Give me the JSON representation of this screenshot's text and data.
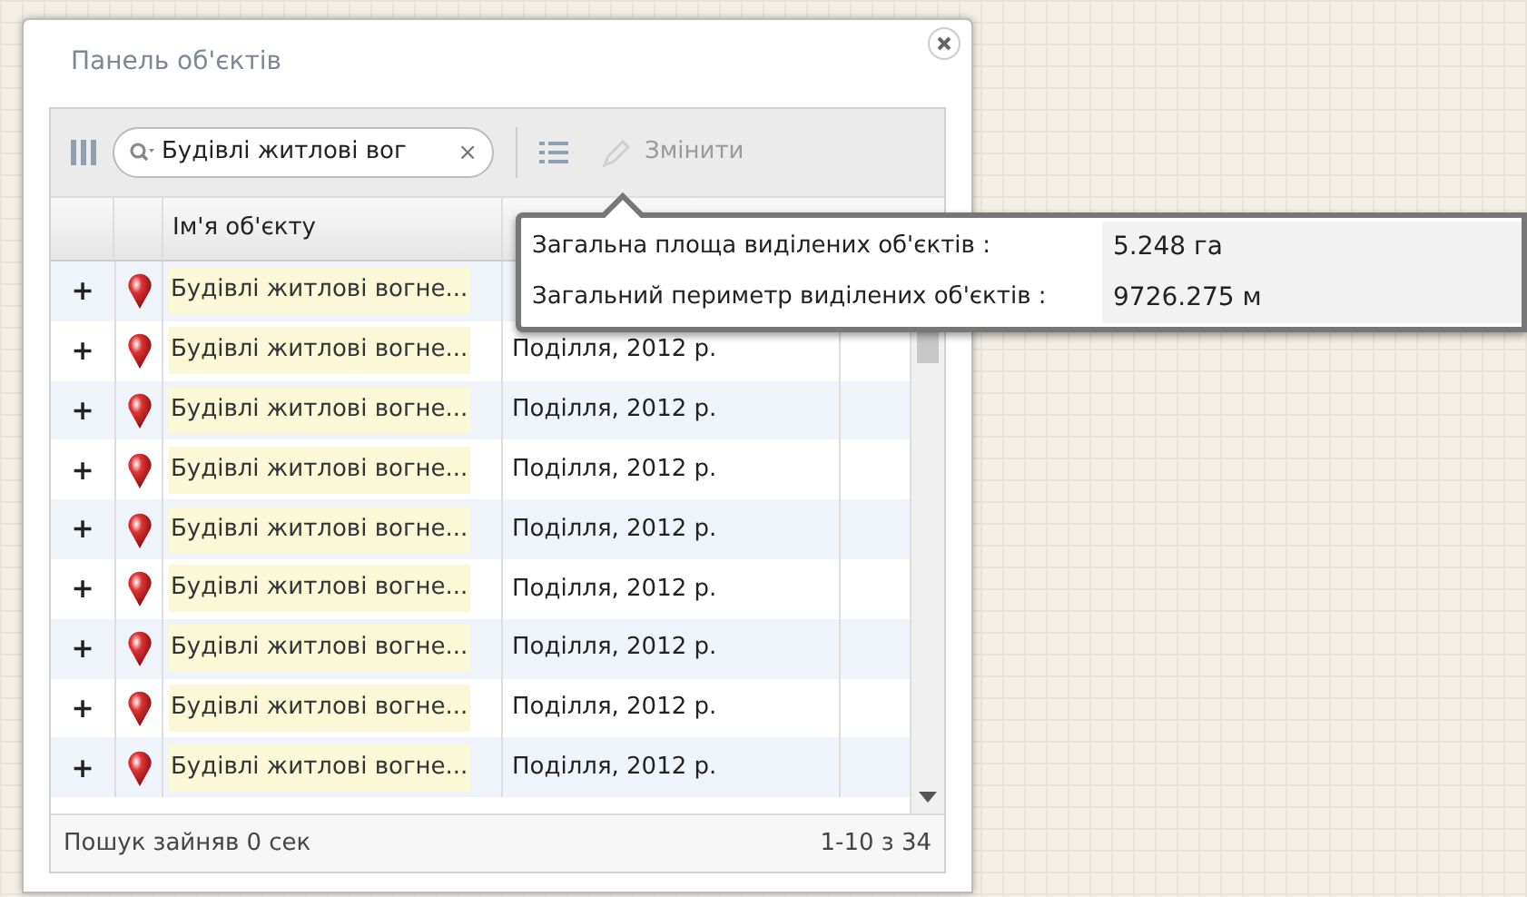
{
  "panel": {
    "title": "Панель об'єктів"
  },
  "toolbar": {
    "search": {
      "value": "Будівлі житлові вог",
      "clear": "×"
    },
    "edit_button": {
      "label": "Змінити",
      "disabled": true
    }
  },
  "table": {
    "columns": [
      "Ім'я об'єкту"
    ],
    "rows": [
      {
        "expand": "+",
        "name": "Будівлі житлові вогне..."
      },
      {
        "expand": "+",
        "name": "Будівлі житлові вогне...",
        "region": "Поділля, 2012 р."
      },
      {
        "expand": "+",
        "name": "Будівлі житлові вогне...",
        "region": "Поділля, 2012 р."
      },
      {
        "expand": "+",
        "name": "Будівлі житлові вогне...",
        "region": "Поділля, 2012 р."
      },
      {
        "expand": "+",
        "name": "Будівлі житлові вогне...",
        "region": "Поділля, 2012 р."
      },
      {
        "expand": "+",
        "name": "Будівлі житлові вогне...",
        "region": "Поділля, 2012 р."
      },
      {
        "expand": "+",
        "name": "Будівлі житлові вогне...",
        "region": "Поділля, 2012 р."
      },
      {
        "expand": "+",
        "name": "Будівлі житлові вогне...",
        "region": "Поділля, 2012 р."
      },
      {
        "expand": "+",
        "name": "Будівлі житлові вогне...",
        "region": "Поділля, 2012 р."
      }
    ]
  },
  "status_bar": {
    "search_time": "Пошук зайняв 0 сек",
    "paging": "1-10 з 34"
  },
  "tooltip": {
    "rows": [
      {
        "label": "Загальна площа виділених об'єктів :",
        "value": "5.248 га"
      },
      {
        "label": "Загальний периметр виділених об'єктів :",
        "value": "9726.275 м"
      }
    ]
  }
}
